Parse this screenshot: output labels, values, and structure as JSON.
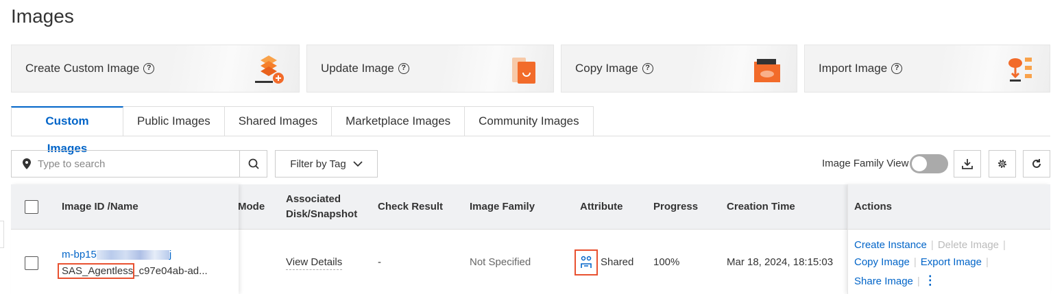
{
  "page_title": "Images",
  "cards": [
    {
      "label": "Create Custom Image",
      "help": "?"
    },
    {
      "label": "Update Image",
      "help": "?"
    },
    {
      "label": "Copy Image",
      "help": "?"
    },
    {
      "label": "Import Image",
      "help": "?"
    }
  ],
  "tabs": [
    "Custom Images",
    "Public Images",
    "Shared Images",
    "Marketplace Images",
    "Community Images"
  ],
  "search": {
    "placeholder": "Type to search"
  },
  "filter_label": "Filter by Tag",
  "family_view_label": "Image Family View",
  "family_view_on": false,
  "columns": [
    "Image ID /Name",
    "Mode",
    "Associated Disk/Snapshot",
    "Check Result",
    "Image Family",
    "Attribute",
    "Progress",
    "Creation Time",
    "Actions"
  ],
  "rows": [
    {
      "id_prefix": "m-bp15",
      "id_suffix": "j",
      "name_highlight": "SAS_Agentless_",
      "name_rest": "c97e04ab-ad...",
      "disk": "View Details",
      "check": "-",
      "family": "Not Specified",
      "attribute": "Shared",
      "progress": "100%",
      "created": "Mar 18, 2024, 18:15:03",
      "actions": [
        "Create Instance",
        "Delete Image",
        "Copy Image",
        "Export Image",
        "Share Image"
      ]
    }
  ],
  "colors": {
    "accent": "#0064c8",
    "highlight": "#e8502f",
    "icon_orange": "#f26b2a"
  }
}
